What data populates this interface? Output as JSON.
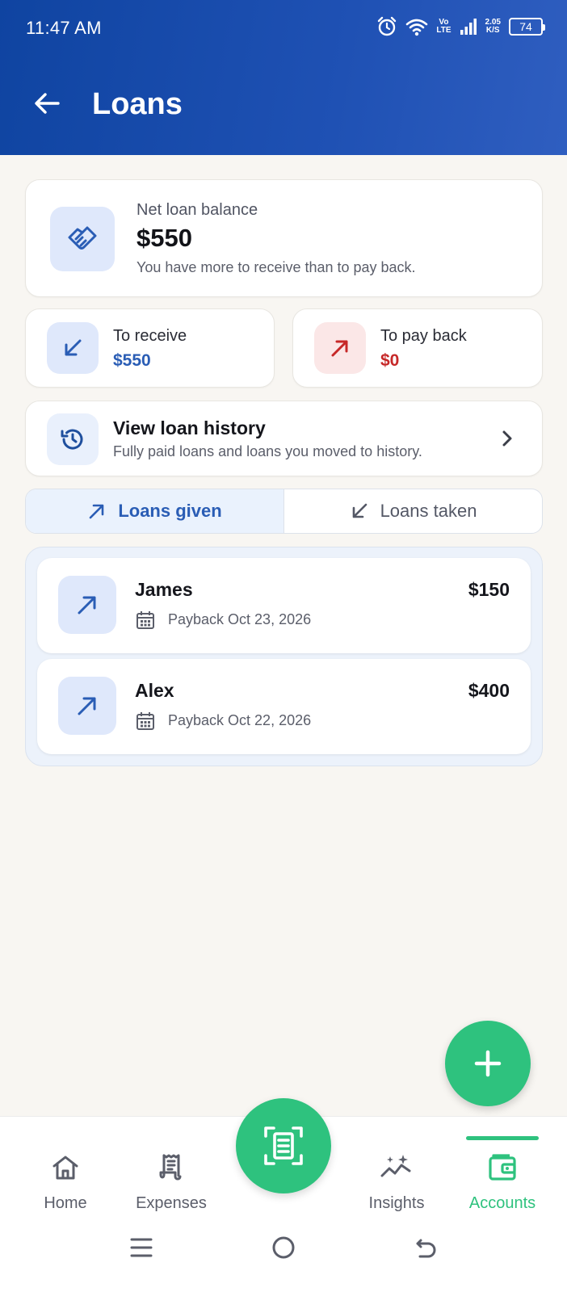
{
  "status_bar": {
    "time": "11:47 AM",
    "volte_top": "Vo",
    "volte_bottom": "LTE",
    "speed_value": "2.05",
    "speed_unit": "K/S",
    "battery": "74"
  },
  "header": {
    "title": "Loans"
  },
  "net_balance": {
    "label": "Net loan balance",
    "value": "$550",
    "caption": "You have more to receive than to pay back."
  },
  "to_receive": {
    "label": "To receive",
    "value": "$550"
  },
  "to_pay_back": {
    "label": "To pay back",
    "value": "$0"
  },
  "history": {
    "title": "View loan history",
    "subtitle": "Fully paid loans and loans you moved to history."
  },
  "tabs": {
    "given": "Loans given",
    "taken": "Loans taken",
    "active": "given"
  },
  "loans": [
    {
      "name": "James",
      "amount": "$150",
      "payback": "Payback Oct 23, 2026"
    },
    {
      "name": "Alex",
      "amount": "$400",
      "payback": "Payback Oct 22, 2026"
    }
  ],
  "bottom_nav": {
    "home": "Home",
    "expenses": "Expenses",
    "insights": "Insights",
    "accounts": "Accounts",
    "active": "accounts"
  },
  "colors": {
    "header": "#1f51b4",
    "accent_blue": "#2a5db5",
    "accent_red": "#c62828",
    "accent_green": "#2ec27e"
  },
  "icons": {
    "back": "arrow-left-icon",
    "net": "handshake-icon",
    "receive": "arrow-down-left-icon",
    "pay": "arrow-up-right-icon",
    "history": "history-icon",
    "add": "plus-icon",
    "scan": "scan-receipt-icon"
  }
}
